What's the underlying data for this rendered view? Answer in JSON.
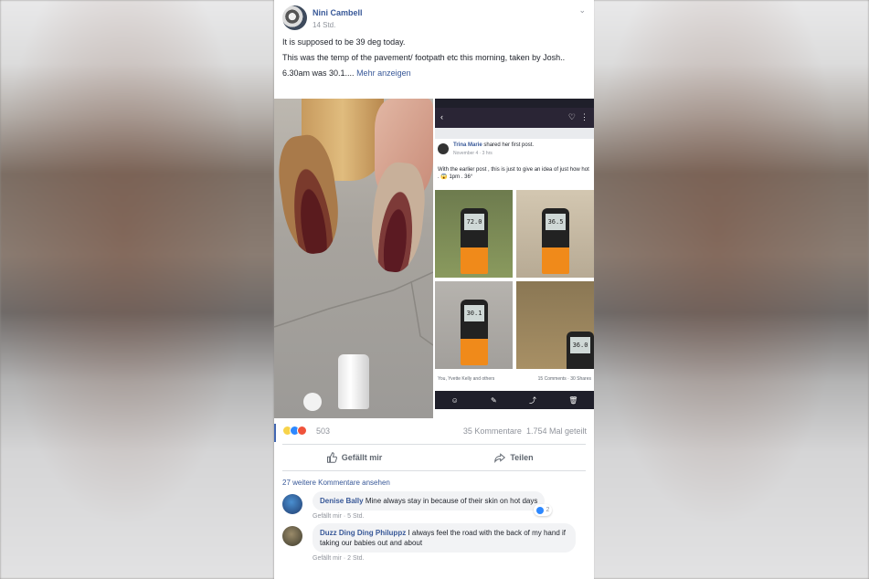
{
  "post": {
    "author": "Nini Cambell",
    "time": "14 Std.",
    "text": [
      "It is supposed to be 39 deg today.",
      "This was the temp of the pavement/ footpath etc this morning, taken by Josh..",
      "6.30am was 30.1...."
    ],
    "more_label": "Mehr anzeigen"
  },
  "shared": {
    "name": "Trina Marie",
    "action": "shared her first post.",
    "sub": "November 4 · 3 hrs",
    "text": "With the earlier post , this is just to give an idea of just how hot . 😱 1pm . 36°",
    "readings": [
      "72.0",
      "36.5",
      "30.1",
      "36.0"
    ],
    "reactions": "You, Yvette Kelly and others",
    "comments_count": "15 Comments · 30 Shares"
  },
  "stats": {
    "reactions_count": "503",
    "comments": "35 Kommentare",
    "shares": "1.754 Mal geteilt"
  },
  "actions": {
    "like": "Gefällt mir",
    "share": "Teilen"
  },
  "comments": {
    "more_label": "27 weitere Kommentare ansehen",
    "items": [
      {
        "name": "Denise Bally",
        "text": "Mine always stay in because of their skin on hot days",
        "like": "Gefällt mir",
        "time": "5 Std.",
        "reactions": "2"
      },
      {
        "name": "Duzz Ding Ding Philuppz",
        "text": "I always feel the road with the back of my hand if taking our babies out and about",
        "like": "Gefällt mir",
        "time": "2 Std."
      }
    ]
  },
  "colors": {
    "link": "#385898",
    "meta": "#90949c",
    "accent": "#4267b2"
  }
}
